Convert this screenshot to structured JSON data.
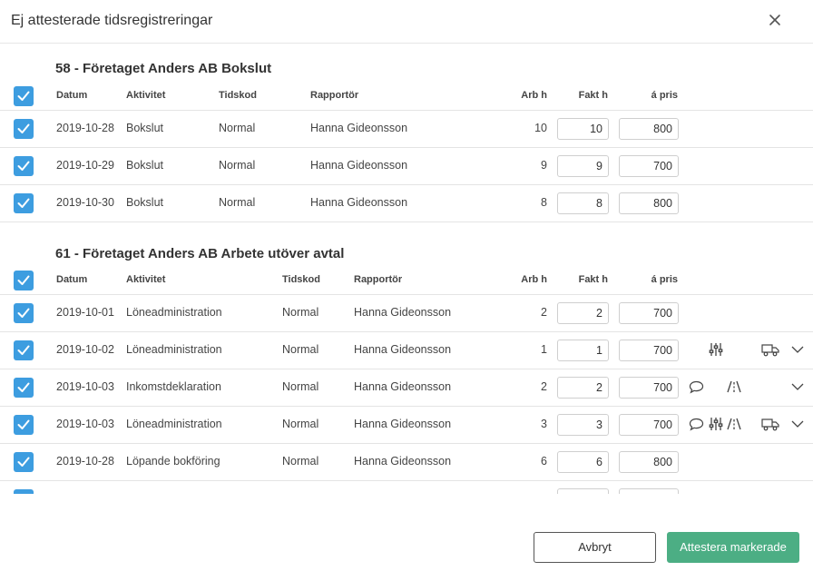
{
  "dialog": {
    "title": "Ej attesterade tidsregistreringar",
    "close_icon": "close-icon"
  },
  "columns": {
    "datum": "Datum",
    "aktivitet": "Aktivitet",
    "tidskod": "Tidskod",
    "rapportor": "Rapportör",
    "arb_h": "Arb h",
    "fakt_h": "Fakt h",
    "a_pris": "á pris"
  },
  "groups": [
    {
      "title": "58 - Företaget Anders AB Bokslut",
      "rows": [
        {
          "datum": "2019-10-28",
          "aktivitet": "Bokslut",
          "tidskod": "Normal",
          "rapportor": "Hanna Gideonsson",
          "arb_h": "10",
          "fakt_h": "10",
          "a_pris": "800"
        },
        {
          "datum": "2019-10-29",
          "aktivitet": "Bokslut",
          "tidskod": "Normal",
          "rapportor": "Hanna Gideonsson",
          "arb_h": "9",
          "fakt_h": "9",
          "a_pris": "700"
        },
        {
          "datum": "2019-10-30",
          "aktivitet": "Bokslut",
          "tidskod": "Normal",
          "rapportor": "Hanna Gideonsson",
          "arb_h": "8",
          "fakt_h": "8",
          "a_pris": "800"
        }
      ]
    },
    {
      "title": "61 - Företaget Anders AB Arbete utöver avtal",
      "rows": [
        {
          "datum": "2019-10-01",
          "aktivitet": "Löneadministration",
          "tidskod": "Normal",
          "rapportor": "Hanna Gideonsson",
          "arb_h": "2",
          "fakt_h": "2",
          "a_pris": "700"
        },
        {
          "datum": "2019-10-02",
          "aktivitet": "Löneadministration",
          "tidskod": "Normal",
          "rapportor": "Hanna Gideonsson",
          "arb_h": "1",
          "fakt_h": "1",
          "a_pris": "700"
        },
        {
          "datum": "2019-10-03",
          "aktivitet": "Inkomstdeklaration",
          "tidskod": "Normal",
          "rapportor": "Hanna Gideonsson",
          "arb_h": "2",
          "fakt_h": "2",
          "a_pris": "700"
        },
        {
          "datum": "2019-10-03",
          "aktivitet": "Löneadministration",
          "tidskod": "Normal",
          "rapportor": "Hanna Gideonsson",
          "arb_h": "3",
          "fakt_h": "3",
          "a_pris": "700"
        },
        {
          "datum": "2019-10-28",
          "aktivitet": "Löpande bokföring",
          "tidskod": "Normal",
          "rapportor": "Hanna Gideonsson",
          "arb_h": "6",
          "fakt_h": "6",
          "a_pris": "800"
        }
      ]
    }
  ],
  "row_icons": {
    "g1r1": [
      "sliders-icon",
      "truck-icon",
      "chevron-down-icon"
    ],
    "g1r2": [
      "comment-icon",
      "road-icon",
      "chevron-down-icon"
    ],
    "g1r3": [
      "comment-icon",
      "sliders-icon",
      "road-icon",
      "truck-icon",
      "chevron-down-icon"
    ]
  },
  "footer": {
    "cancel_label": "Avbryt",
    "submit_label": "Attestera markerade"
  },
  "colors": {
    "checkbox": "#3d9de0",
    "primary_button": "#4cae84"
  }
}
